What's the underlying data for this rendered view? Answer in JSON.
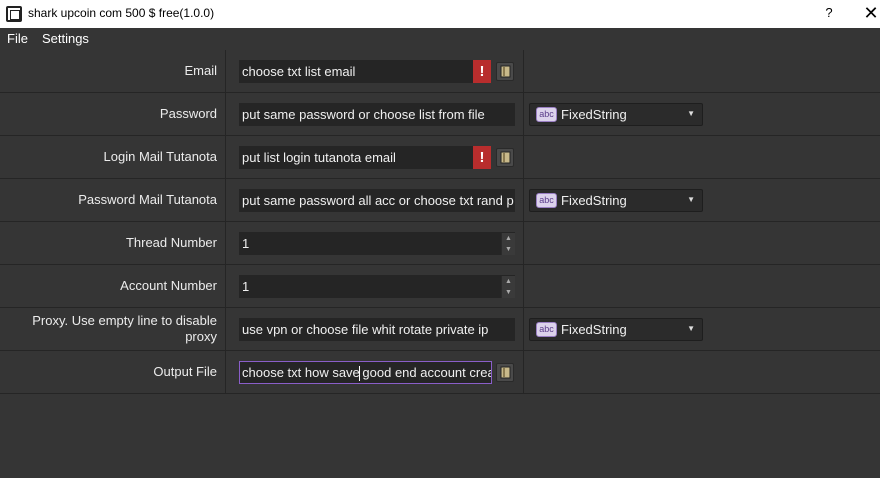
{
  "window": {
    "title": "shark upcoin com 500 $ free(1.0.0)",
    "help_label": "?",
    "close_label": "✕"
  },
  "menu": [
    {
      "label": "File"
    },
    {
      "label": "Settings"
    }
  ],
  "combo_label": "FixedString",
  "abc_label": "abc",
  "rows": {
    "email": {
      "label": "Email",
      "value": "choose txt list email",
      "warning": "!"
    },
    "password": {
      "label": "Password",
      "value": "put same password or choose list from file"
    },
    "login_tutanota": {
      "label": "Login Mail Tutanota",
      "value": "put list login tutanota email",
      "warning": "!"
    },
    "password_tutanota": {
      "label": "Password Mail Tutanota",
      "value": "put same password all acc or choose txt rand p"
    },
    "thread_number": {
      "label": "Thread Number",
      "value": "1"
    },
    "account_number": {
      "label": "Account Number",
      "value": "1"
    },
    "proxy": {
      "label": "Proxy. Use empty line to disable proxy",
      "value": "use vpn or choose file whit rotate private ip"
    },
    "output_file": {
      "label": "Output File",
      "value_before_caret": "choose txt how save",
      "value_after_caret": " good end account crea"
    }
  },
  "icons": {
    "warning": "warning-icon",
    "folder": "folder-icon",
    "dropdown": "chevron-down-icon"
  },
  "colors": {
    "background": "#353535",
    "input_bg": "#252525",
    "warning": "#b82d2d",
    "focus_border": "#8a5ec9"
  }
}
